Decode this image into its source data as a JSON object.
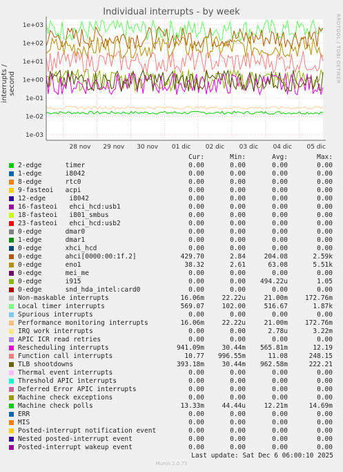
{
  "header": {
    "title": "Individual interrupts - by week",
    "watermark": "RRDTOOL / TOBI OETIKER"
  },
  "chart_data": {
    "type": "line",
    "title": "Individual interrupts - by week",
    "ylabel": "interrupts / second",
    "yscale": "log",
    "ylim": [
      0.0005,
      2000
    ],
    "y_ticks": [
      "1e+03",
      "1e+02",
      "1e+01",
      "1e+00",
      "1e-01",
      "1e-02",
      "1e-03"
    ],
    "x_ticks": [
      "28 nov",
      "29 nov",
      "30 nov",
      "01 dic",
      "02 dic",
      "03 dic",
      "04 dic",
      "05 dic"
    ],
    "series_approx": [
      {
        "name": "Non-maskable interrupts",
        "color": "#00cc00",
        "level": 0.016
      },
      {
        "name": "Local timer interrupts",
        "color": "#66ff66",
        "level": 520
      },
      {
        "name": "ahci[0000:00:1f.2]",
        "color": "#b35a00",
        "level": 200
      },
      {
        "name": "eno1",
        "color": "#b38f00",
        "level": 60
      },
      {
        "name": "i915",
        "color": "#8fb300",
        "level": 1.0
      },
      {
        "name": "Rescheduling interrupts",
        "color": "#e600e6",
        "level": 0.6
      },
      {
        "name": "Function call interrupts",
        "color": "#ff8080",
        "level": 10
      },
      {
        "name": "TLB shootdowns",
        "color": "#4d4d00",
        "level": 0.9
      },
      {
        "name": "Performance monitoring interrupts",
        "color": "#ffcc99",
        "level": 0.03
      }
    ],
    "grid": true
  },
  "legend": {
    "headers": {
      "cur": "Cur:",
      "min": "Min:",
      "avg": "Avg:",
      "max": "Max:"
    },
    "rows": [
      {
        "name": "2-edge      timer",
        "color": "#00cc00",
        "cur": "0.00",
        "min": "0.00",
        "avg": "0.00",
        "max": "0.00"
      },
      {
        "name": "1-edge      i8042",
        "color": "#0066b3",
        "cur": "0.00",
        "min": "0.00",
        "avg": "0.00",
        "max": "0.00"
      },
      {
        "name": "8-edge      rtc0",
        "color": "#ff8000",
        "cur": "0.00",
        "min": "0.00",
        "avg": "0.00",
        "max": "0.00"
      },
      {
        "name": "9-fasteoi   acpi",
        "color": "#ffcc00",
        "cur": "0.00",
        "min": "0.00",
        "avg": "0.00",
        "max": "0.00"
      },
      {
        "name": "12-edge      i8042",
        "color": "#330099",
        "cur": "0.00",
        "min": "0.00",
        "avg": "0.00",
        "max": "0.00"
      },
      {
        "name": "16-fasteoi   ehci_hcd:usb1",
        "color": "#990099",
        "cur": "0.00",
        "min": "0.00",
        "avg": "0.00",
        "max": "0.00"
      },
      {
        "name": "18-fasteoi   i801_smbus",
        "color": "#ccff00",
        "cur": "0.00",
        "min": "0.00",
        "avg": "0.00",
        "max": "0.00"
      },
      {
        "name": "23-fasteoi   ehci_hcd:usb2",
        "color": "#ff0000",
        "cur": "0.00",
        "min": "0.00",
        "avg": "0.00",
        "max": "0.00"
      },
      {
        "name": "0-edge      dmar0",
        "color": "#808080",
        "cur": "0.00",
        "min": "0.00",
        "avg": "0.00",
        "max": "0.00"
      },
      {
        "name": "1-edge      dmar1",
        "color": "#008f00",
        "cur": "0.00",
        "min": "0.00",
        "avg": "0.00",
        "max": "0.00"
      },
      {
        "name": "0-edge      xhci_hcd",
        "color": "#00487d",
        "cur": "0.00",
        "min": "0.00",
        "avg": "0.00",
        "max": "0.00"
      },
      {
        "name": "0-edge      ahci[0000:00:1f.2]",
        "color": "#b35a00",
        "cur": "429.70",
        "min": "2.84",
        "avg": "204.08",
        "max": "2.59k"
      },
      {
        "name": "0-edge      eno1",
        "color": "#b38f00",
        "cur": "38.32",
        "min": "2.61",
        "avg": "63.08",
        "max": "5.51k"
      },
      {
        "name": "0-edge      mei_me",
        "color": "#6b006b",
        "cur": "0.00",
        "min": "0.00",
        "avg": "0.00",
        "max": "0.00"
      },
      {
        "name": "0-edge      i915",
        "color": "#8fb300",
        "cur": "0.00",
        "min": "0.00",
        "avg": "494.22u",
        "max": "1.05"
      },
      {
        "name": "0-edge      snd_hda_intel:card0",
        "color": "#b30000",
        "cur": "0.00",
        "min": "0.00",
        "avg": "0.00",
        "max": "0.00"
      },
      {
        "name": "Non-maskable interrupts",
        "color": "#bebebe",
        "cur": "16.06m",
        "min": "22.22u",
        "avg": "21.00m",
        "max": "172.76m"
      },
      {
        "name": "Local timer interrupts",
        "color": "#80ff80",
        "cur": "569.07",
        "min": "102.00",
        "avg": "516.67",
        "max": "1.87k"
      },
      {
        "name": "Spurious interrupts",
        "color": "#80c9ff",
        "cur": "0.00",
        "min": "0.00",
        "avg": "0.00",
        "max": "0.00"
      },
      {
        "name": "Performance monitoring interrupts",
        "color": "#ffc080",
        "cur": "16.06m",
        "min": "22.22u",
        "avg": "21.00m",
        "max": "172.76m"
      },
      {
        "name": "IRQ work interrupts",
        "color": "#ffe680",
        "cur": "0.00",
        "min": "0.00",
        "avg": "2.78u",
        "max": "3.22m"
      },
      {
        "name": "APIC ICR read retries",
        "color": "#aa80ff",
        "cur": "0.00",
        "min": "0.00",
        "avg": "0.00",
        "max": "0.00"
      },
      {
        "name": "Rescheduling interrupts",
        "color": "#ee00cc",
        "cur": "941.09m",
        "min": "30.44m",
        "avg": "565.81m",
        "max": "12.19"
      },
      {
        "name": "Function call interrupts",
        "color": "#ff8080",
        "cur": "10.77",
        "min": "996.55m",
        "avg": "11.08",
        "max": "248.15"
      },
      {
        "name": "TLB shootdowns",
        "color": "#666600",
        "cur": "393.18m",
        "min": "30.44m",
        "avg": "962.58m",
        "max": "222.21"
      },
      {
        "name": "Thermal event interrupts",
        "color": "#ffbfff",
        "cur": "0.00",
        "min": "0.00",
        "avg": "0.00",
        "max": "0.00"
      },
      {
        "name": "Threshold APIC interrupts",
        "color": "#00ffcc",
        "cur": "0.00",
        "min": "0.00",
        "avg": "0.00",
        "max": "0.00"
      },
      {
        "name": "Deferred Error APIC interrupts",
        "color": "#cc6699",
        "cur": "0.00",
        "min": "0.00",
        "avg": "0.00",
        "max": "0.00"
      },
      {
        "name": "Machine check exceptions",
        "color": "#999900",
        "cur": "0.00",
        "min": "0.00",
        "avg": "0.00",
        "max": "0.00"
      },
      {
        "name": "Machine check polls",
        "color": "#00cc00",
        "cur": "13.33m",
        "min": "44.44u",
        "avg": "12.21m",
        "max": "14.69m"
      },
      {
        "name": "ERR",
        "color": "#0066b3",
        "cur": "0.00",
        "min": "0.00",
        "avg": "0.00",
        "max": "0.00"
      },
      {
        "name": "MIS",
        "color": "#ff8000",
        "cur": "0.00",
        "min": "0.00",
        "avg": "0.00",
        "max": "0.00"
      },
      {
        "name": "Posted-interrupt notification event",
        "color": "#ffcc00",
        "cur": "0.00",
        "min": "0.00",
        "avg": "0.00",
        "max": "0.00"
      },
      {
        "name": "Nested posted-interrupt event",
        "color": "#330099",
        "cur": "0.00",
        "min": "0.00",
        "avg": "0.00",
        "max": "0.00"
      },
      {
        "name": "Posted-interrupt wakeup event",
        "color": "#990099",
        "cur": "0.00",
        "min": "0.00",
        "avg": "0.00",
        "max": "0.00"
      }
    ]
  },
  "footer": {
    "last_update": "Last update: Sat Dec  6 06:00:10 2025",
    "version": "Munin 2.0.75"
  }
}
